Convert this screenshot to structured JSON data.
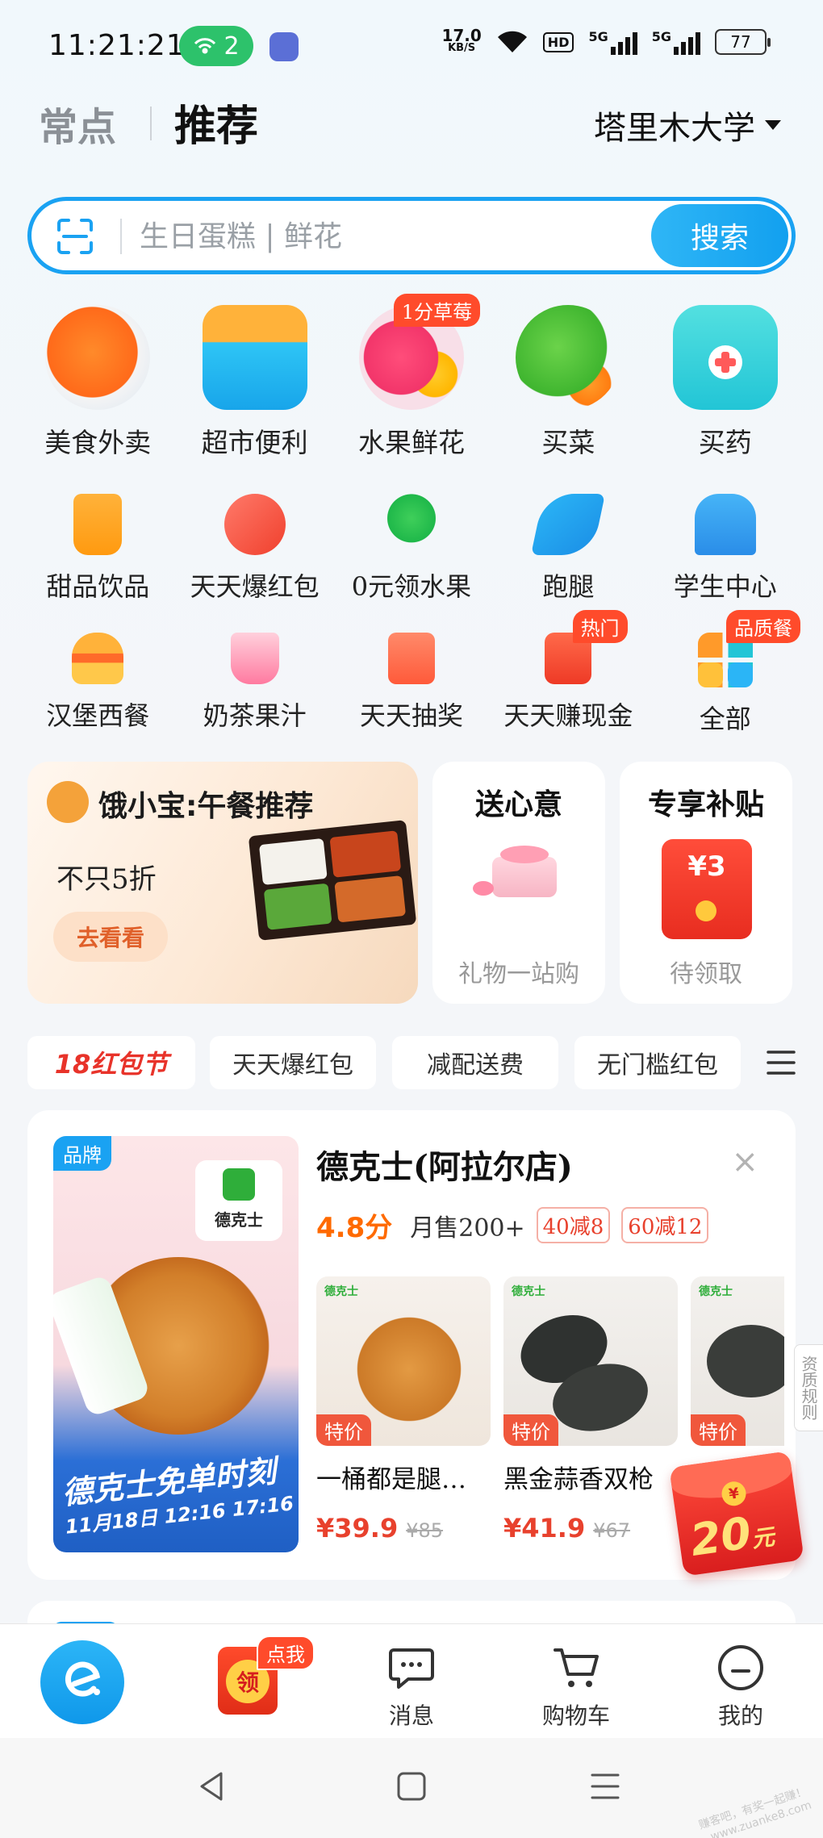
{
  "status_bar": {
    "time": "11:21:21",
    "hotspot_count": "2",
    "net_speed": "17.0",
    "net_unit": "KB/S",
    "hd_label": "HD",
    "sim1": "5G",
    "sim2": "5G",
    "battery": "77"
  },
  "header": {
    "tab_frequent": "常点",
    "tab_recommend": "推荐",
    "location": "塔里木大学"
  },
  "search": {
    "placeholder": "生日蛋糕 | 鲜花",
    "button": "搜索"
  },
  "categories_big": [
    {
      "label": "美食外卖",
      "icon": "food-delivery-icon"
    },
    {
      "label": "超市便利",
      "icon": "supermarket-basket-icon"
    },
    {
      "label": "水果鲜花",
      "icon": "fruit-flower-icon",
      "badge": "1分草莓"
    },
    {
      "label": "买菜",
      "icon": "vegetable-icon"
    },
    {
      "label": "买药",
      "icon": "medicine-icon"
    }
  ],
  "categories_row2": [
    {
      "label": "甜品饮品",
      "icon": "drink-cup-icon"
    },
    {
      "label": "天天爆红包",
      "icon": "red-packet-burst-icon"
    },
    {
      "label": "0元领水果",
      "icon": "tree-icon"
    },
    {
      "label": "跑腿",
      "icon": "runner-icon"
    },
    {
      "label": "学生中心",
      "icon": "school-icon"
    }
  ],
  "categories_row3": [
    {
      "label": "汉堡西餐",
      "icon": "burger-icon"
    },
    {
      "label": "奶茶果汁",
      "icon": "milk-tea-icon"
    },
    {
      "label": "天天抽奖",
      "icon": "lottery-icon"
    },
    {
      "label": "天天赚现金",
      "icon": "cash-envelope-icon",
      "badge": "热门"
    },
    {
      "label": "全部",
      "icon": "grid-all-icon",
      "badge": "品质餐"
    }
  ],
  "promo": {
    "main_title": "饿小宝:午餐推荐",
    "main_sub": "不只5折",
    "main_button": "去看看",
    "gift_title": "送心意",
    "gift_sub": "礼物一站购",
    "subsidy_title": "专享补贴",
    "subsidy_amount": "¥3",
    "subsidy_sub": "待领取"
  },
  "filter_chips": {
    "festival": "18红包节",
    "chip1": "天天爆红包",
    "chip2": "减配送费",
    "chip3": "无门槛红包"
  },
  "store": {
    "brand_tag": "品牌",
    "logo_text": "德克士",
    "poster_headline": "德克士免单时刻",
    "poster_date": "11月18日 12:16 17:16",
    "name": "德克士(阿拉尔店)",
    "rating": "4.8分",
    "monthly_sales": "月售200+",
    "discount1": "40减8",
    "discount2": "60减12",
    "products": [
      {
        "brand": "德克士",
        "tag": "特价",
        "name": "一桶都是腿…",
        "price": "¥39.9",
        "original": "¥85"
      },
      {
        "brand": "德克士",
        "tag": "特价",
        "name": "黑金蒜香双枪",
        "price": "¥41.9",
        "original": "¥67"
      },
      {
        "brand": "德克士",
        "tag": "特价",
        "name": "",
        "price": "",
        "original": ""
      }
    ]
  },
  "rules_tab": "资质规则",
  "floating_packet": {
    "amount": "20",
    "unit": "元",
    "coin": "¥"
  },
  "bottom_nav": {
    "ling_label": "领",
    "ling_badge": "点我",
    "messages": "消息",
    "cart": "购物车",
    "mine": "我的"
  },
  "watermark": {
    "line1": "赚客吧，有奖一起赚！",
    "line2": "www.zuanke8.com"
  },
  "colors": {
    "accent": "#1aa2f2",
    "price": "#e8412d",
    "rating": "#ff6a00",
    "badge": "#ff4b2b"
  }
}
